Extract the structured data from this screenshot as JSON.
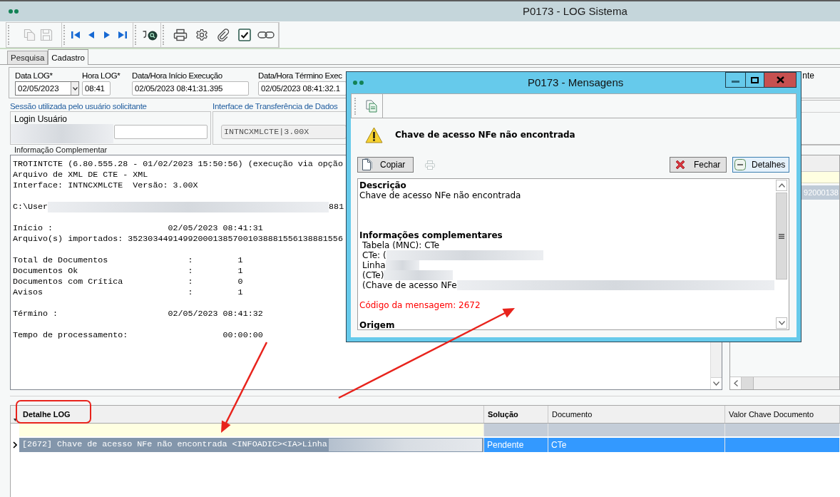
{
  "window": {
    "title": "P0173 - LOG Sistema"
  },
  "toolbar": {
    "groups": [
      [
        {
          "disabled": true
        },
        {
          "disabled": true
        }
      ],
      [
        {
          "disabled": false
        },
        {
          "disabled": false
        },
        {
          "disabled": false
        },
        {
          "disabled": false
        }
      ],
      [
        {
          "disabled": false
        }
      ],
      [
        {
          "disabled": false
        },
        {
          "disabled": false
        },
        {
          "disabled": false
        },
        {
          "disabled": false
        },
        {
          "disabled": false
        }
      ]
    ]
  },
  "tabs": [
    {
      "label": "Pesquisa",
      "selected": false
    },
    {
      "label": "Cadastro",
      "selected": true
    }
  ],
  "form": {
    "fields": [
      {
        "label": "Data LOG*",
        "value": "02/05/2023",
        "kind": "date"
      },
      {
        "label": "Hora LOG*",
        "value": "08:41",
        "kind": "text"
      },
      {
        "label": "Data/Hora Início Execução",
        "value": "02/05/2023 08:41:31.395",
        "kind": "text"
      },
      {
        "label": "Data/Hora Término Exec",
        "value": "02/05/2023 08:41:32.1",
        "kind": "text"
      }
    ],
    "covered_label": "nte"
  },
  "session_group": {
    "title": "Sessão utilizada pelo usuário solicitante",
    "login_label": "Login Usuário",
    "login_blurred": true
  },
  "interface_group": {
    "title": "Interface de Transferência de Dados",
    "value": "INTNCXMLCTE|3.00X",
    "disabled": true
  },
  "complementary_info": {
    "label": "Informação Complementar",
    "blocks": [
      [
        {
          "text": "TROTINTCTE (6.80.555.28 - 01/02/2023 15:50:56) (execução via opção"
        },
        {
          "text": "Arquivo de XML DE CTE - XML"
        },
        {
          "text": "Interface: INTNCXMLCTE  Versão: 3.00X"
        }
      ],
      [
        {
          "text": "C:\\User",
          "blurred": true,
          "tail": "881"
        }
      ],
      [
        {
          "text": "Início :                       02/05/2023 08:41:31"
        },
        {
          "text": "Arquivo(s) importados: 3523034491499200013857001038881556138881556"
        }
      ],
      [
        {
          "text": "Total de Documentos                :         1"
        },
        {
          "text": "Documentos Ok                      :         1"
        },
        {
          "text": "Documentos com Crítica             :         0"
        },
        {
          "text": "Avisos                             :         1"
        }
      ],
      [
        {
          "text": "Término :                      02/05/2023 08:41:32"
        }
      ],
      [
        {
          "text": "Tempo de processamento:                   00:00:00"
        }
      ]
    ]
  },
  "side_table": {
    "rows": [
      {
        "cells": [
          "92000138"
        ],
        "selected": true
      }
    ]
  },
  "detail_grid": {
    "columns": [
      {
        "label": "Detalhe LOG",
        "bold": true
      },
      {
        "label": "Solução",
        "bold": true
      },
      {
        "label": "Documento",
        "bold": false
      },
      {
        "label": "Valor Chave Documento",
        "bold": false
      }
    ],
    "rows": [
      {
        "current": true,
        "selected": true,
        "cells": [
          {
            "text": "[2672] Chave de acesso NFe não encontrada <INFOADIC><IA>Linha",
            "blurred": true,
            "focused": true
          },
          {
            "text": "Pendente"
          },
          {
            "text": "CTe"
          }
        ]
      }
    ]
  },
  "dialog": {
    "title": "P0173 - Mensagens",
    "message": "Chave de acesso NFe não encontrada",
    "copy_button": {
      "label": "Copiar"
    },
    "print_button": {
      "disabled": true
    },
    "close_button": {
      "label": "Fechar"
    },
    "details_button": {
      "label": "Detalhes",
      "focused": true
    },
    "details": {
      "blocks": [
        {
          "kind": "section",
          "heading": "Descrição",
          "lines": [
            {
              "text": "Chave de acesso NFe não encontrada"
            }
          ]
        },
        {
          "kind": "section",
          "heading": "Informações complementares",
          "lines": [
            {
              "text": "Tabela (MNC): CTe"
            },
            {
              "text": "CTe: (",
              "blurred": true
            },
            {
              "text": "Linha",
              "blurred": true
            },
            {
              "text": "(CTe)",
              "blurred": true
            },
            {
              "text": "(Chave de acesso NFe",
              "blurred": true
            }
          ]
        },
        {
          "kind": "code",
          "text": "Código da mensagem: 2672"
        },
        {
          "kind": "section",
          "heading": "Origem"
        }
      ]
    }
  }
}
